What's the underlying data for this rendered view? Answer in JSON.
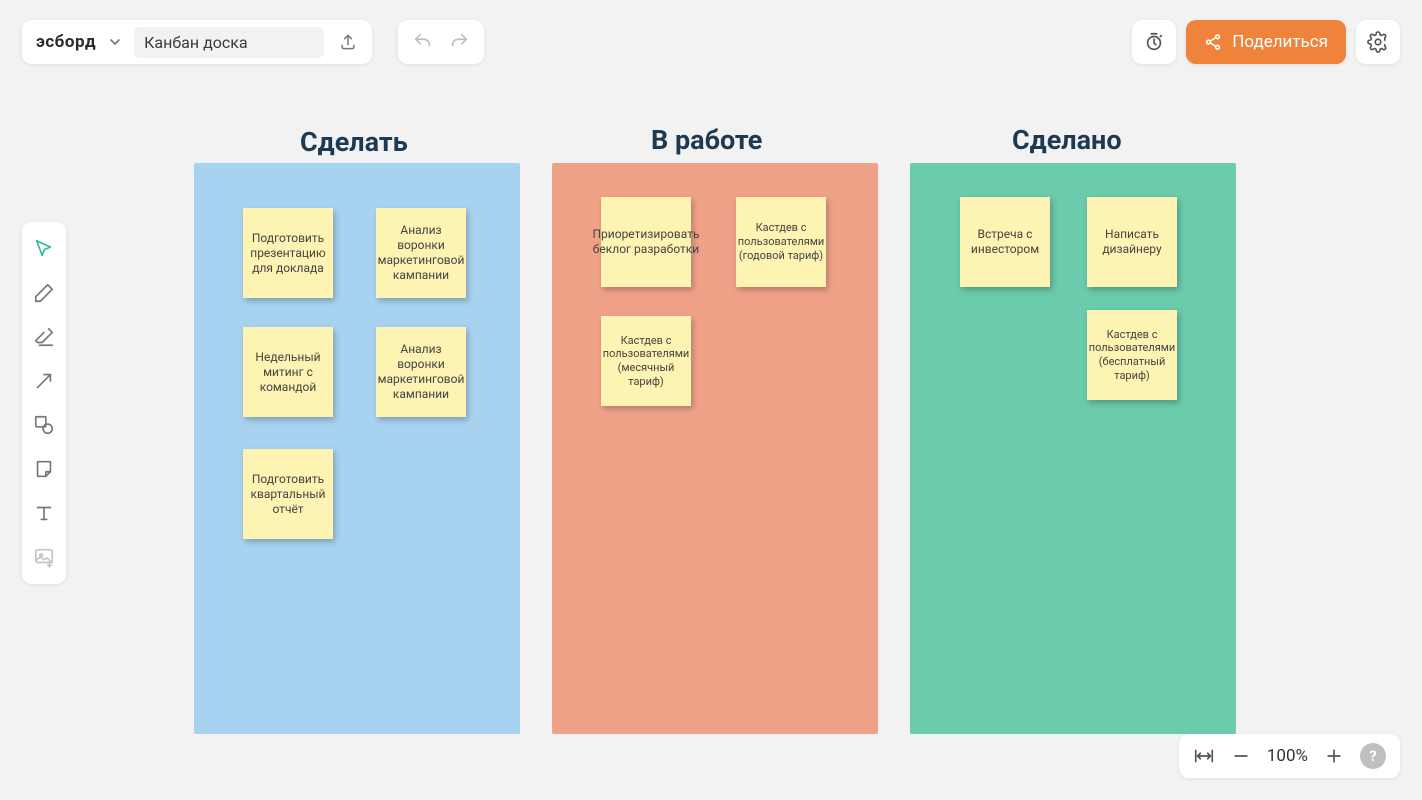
{
  "logo": "эсборд",
  "doc_name": "Канбан доска",
  "share_label": "Поделиться",
  "zoom_label": "100%",
  "columns": {
    "todo": {
      "title": "Сделать"
    },
    "doing": {
      "title": "В работе"
    },
    "done": {
      "title": "Сделано"
    }
  },
  "cards": {
    "todo": [
      "Подготовить презентацию для доклада",
      "Анализ воронки маркетинговой кампании",
      "Недельный митинг с командой",
      "Анализ воронки маркетинговой кампании",
      "Подготовить квартальный отчёт"
    ],
    "doing": [
      "Приоретизировать беклог разработки",
      "Кастдев с пользователями (годовой тариф)",
      "Кастдев с пользователями (месячный тариф)"
    ],
    "done": [
      "Встреча с инвестором",
      "Написать дизайнеру",
      "Кастдев с пользователями (бесплатный тариф)"
    ]
  }
}
